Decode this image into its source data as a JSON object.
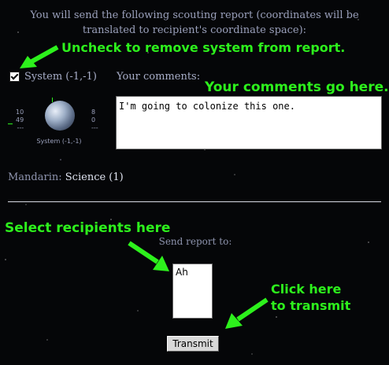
{
  "intro_text": "You will send the following scouting report (coordinates will be translated to recipient's coordinate space):",
  "annotations": {
    "uncheck": "Uncheck to remove system from report.",
    "comments": "Your comments go here.",
    "recipients": "Select recipients here",
    "transmit_line1": "Click here",
    "transmit_line2": "to transmit"
  },
  "system": {
    "label": "System (-1,-1)",
    "checked": true,
    "caption": "System (-1,-1)",
    "stats_left": [
      "10",
      "49",
      "---"
    ],
    "stats_right": [
      "8",
      "0",
      "---"
    ]
  },
  "comments": {
    "label": "Your comments:",
    "value": "I'm going to colonize this one."
  },
  "resource": {
    "name": "Mandarin:",
    "value": "Science (1)"
  },
  "send": {
    "label": "Send report to:",
    "recipients": [
      "Ah"
    ]
  },
  "transmit_label": "Transmit",
  "colors": {
    "annotation": "#2df11c",
    "background": "#050608",
    "text": "#a8aec8"
  }
}
